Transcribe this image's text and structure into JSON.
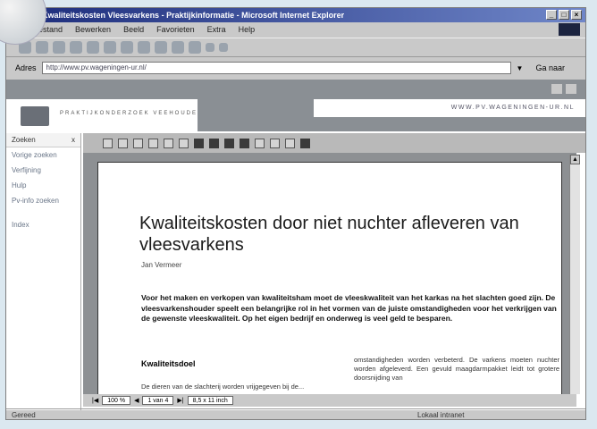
{
  "window": {
    "title": "Kwaliteitskosten door niet nuchter afleveren van vleesvarkens - Microsoft Internet Explorer",
    "title_visible": "Kwaliteitskosten Vleesvarkens - Praktijkinformatie - Microsoft Internet Explorer"
  },
  "menu": [
    "Bestand",
    "Bewerken",
    "Beeld",
    "Favorieten",
    "Extra",
    "Help"
  ],
  "address": {
    "label": "Adres",
    "value": "http://www.pv.wageningen-ur.nl/",
    "go_label": "Ga naar"
  },
  "site": {
    "logo_text": "PRAKTIJKONDERZOEK VEEHOUDERIJ",
    "url_text": "WWW.PV.WAGENINGEN-UR.NL"
  },
  "leftnav": {
    "header": "Zoeken",
    "close": "x",
    "items": [
      "Vorige zoeken",
      "Verfijning",
      "Hulp",
      "Pv-info zoeken",
      "Index"
    ]
  },
  "document": {
    "title": "Kwaliteitskosten door niet nuchter afleveren van vleesvarkens",
    "author": "Jan Vermeer",
    "intro": "Voor het maken en verkopen van kwaliteitsham moet de vleeskwaliteit van het karkas na het slachten goed zijn. De vleesvarkenshouder speelt een belangrijke rol in het vormen van de juiste omstandigheden voor het verkrijgen van de gewenste vleeskwaliteit. Op het eigen bedrijf en onderweg is veel geld te besparen.",
    "section_heading": "Kwaliteitsdoel",
    "col1_text": "De dieren van de slachterij worden vrijgegeven bij de...",
    "col2_text": "omstandigheden worden verbeterd. De varkens moeten nuchter worden afgeleverd. Een gevuld maagdarmpakket leidt tot grotere doorsnijding van"
  },
  "pdf_status": {
    "zoom": "100 %",
    "page": "1 van 4",
    "size": "8,5 x 11 inch"
  },
  "status": {
    "left": "Gereed",
    "zone": "Lokaal intranet"
  }
}
